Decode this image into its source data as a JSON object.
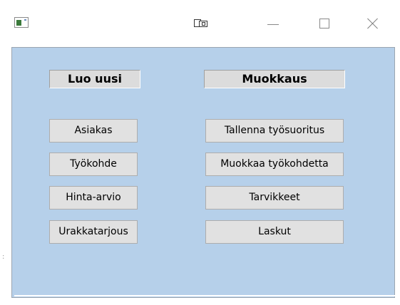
{
  "titlebar": {
    "app_icon": "app-window-icon",
    "center_icon": "pip-window-icon",
    "minimize_glyph": "—",
    "maximize_glyph": "☐",
    "close_glyph": "✕"
  },
  "sections": {
    "create_header": "Luo uusi",
    "edit_header": "Muokkaus"
  },
  "create_buttons": [
    "Asiakas",
    "Työkohde",
    "Hinta-arvio",
    "Urakkatarjous"
  ],
  "edit_buttons": [
    "Tallenna työsuoritus",
    "Muokkaa työkohdetta",
    "Tarvikkeet",
    "Laskut"
  ],
  "colors": {
    "client_background": "#b6d0ea",
    "button_face": "#e1e1e1",
    "button_border": "#adadad"
  }
}
